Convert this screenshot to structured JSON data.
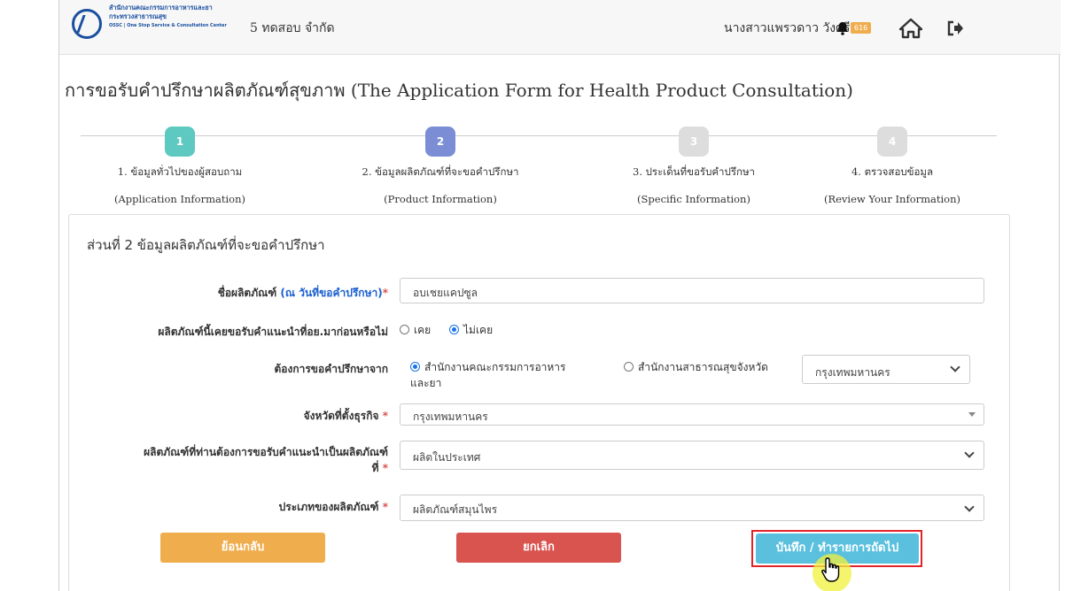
{
  "header": {
    "logo_line1": "สำนักงานคณะกรรมการอาหารและยา",
    "logo_line2": "กระทรวงสาธารณสุข",
    "logo_line3": "OSSC | One Stop Service & Consultation Center",
    "company": "5 ทดสอบ จำกัด",
    "user_name": "นางสาวแพรวดาว วังศรี",
    "notification_count": "616"
  },
  "page_title": "การขอรับคำปรึกษาผลิตภัณฑ์สุขภาพ (The Application Form for Health Product Consultation)",
  "steps": [
    {
      "num": "1",
      "title": "1. ข้อมูลทั่วไปของผู้สอบถาม",
      "subtitle": "(Application Information)",
      "color": "#5ec9c0"
    },
    {
      "num": "2",
      "title": "2. ข้อมูลผลิตภัณฑ์ที่จะขอคำปรึกษา",
      "subtitle": "(Product Information)",
      "color": "#7b8dd4"
    },
    {
      "num": "3",
      "title": "3. ประเด็นที่ขอรับคำปรึกษา",
      "subtitle": "(Specific Information)",
      "color": "#dddddd"
    },
    {
      "num": "4",
      "title": "4. ตรวจสอบข้อมูล",
      "subtitle": "(Review Your Information)",
      "color": "#dddddd"
    }
  ],
  "section": {
    "title": "ส่วนที่ 2 ข้อมูลผลิตภัณฑ์ที่จะขอคำปรึกษา",
    "product_name": {
      "label": "ชื่อผลิตภัณฑ์",
      "label_note": "(ณ วันที่ขอคำปรึกษา)",
      "required": "*",
      "value": "อบเชยแคปซูล"
    },
    "prior_advice": {
      "label": "ผลิตภัณฑ์นี้เคยขอรับคำแนะนำที่อย.มาก่อนหรือไม่",
      "option_yes": "เคย",
      "option_no": "ไม่เคย",
      "selected": "ไม่เคย"
    },
    "consult_from": {
      "label": "ต้องการขอคำปรึกษาจาก",
      "option_fda_line1": "สำนักงานคณะกรรมการอาหาร",
      "option_fda_line2": "และยา",
      "option_provincial": "สำนักงานสาธารณสุขจังหวัด",
      "province_select": "กรุงเทพมหานคร",
      "selected": "สำนักงานคณะกรรมการอาหารและยา"
    },
    "business_province": {
      "label": "จังหวัดที่ตั้งธุรกิจ",
      "required": "*",
      "value": "กรุงเทพมหานคร"
    },
    "product_origin": {
      "label_line1": "ผลิตภัณฑ์ที่ท่านต้องการขอรับคำแนะนำเป็นผลิตภัณฑ์",
      "label_line2": "ที่",
      "required": "*",
      "value": "ผลิตในประเทศ"
    },
    "product_type": {
      "label": "ประเภทของผลิตภัณฑ์",
      "required": "*",
      "value": "ผลิตภัณฑ์สมุนไพร"
    }
  },
  "buttons": {
    "back": "ย้อนกลับ",
    "cancel": "ยกเลิก",
    "save_next": "บันทึก / ทำรายการถัดไป"
  },
  "colors": {
    "back": "#f0ad4e",
    "cancel": "#d9534f",
    "save": "#5bc0de",
    "highlight": "#e0242a"
  }
}
